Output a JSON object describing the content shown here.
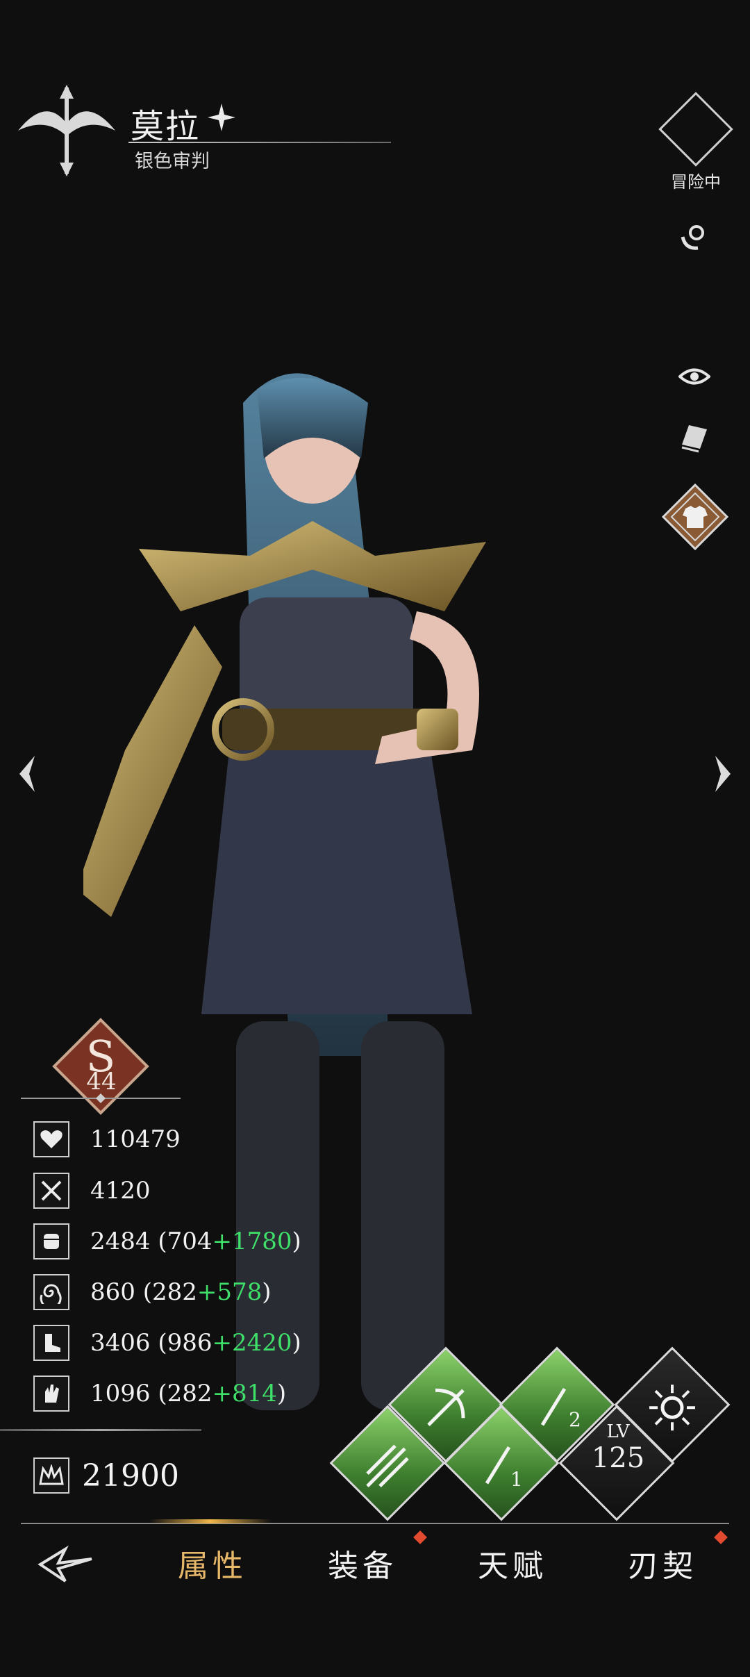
{
  "character": {
    "name": "莫拉",
    "title": "银色审判",
    "status": "冒险中",
    "rank": "44"
  },
  "stats": [
    {
      "icon": "heart-icon",
      "base": "110479",
      "extra_open": "",
      "extra_plus": "",
      "extra_close": ""
    },
    {
      "icon": "crossed-swords-icon",
      "base": "4120",
      "extra_open": "",
      "extra_plus": "",
      "extra_close": ""
    },
    {
      "icon": "fist-icon",
      "base": "2484",
      "extra_open": " (704",
      "extra_plus": "+1780",
      "extra_close": ")"
    },
    {
      "icon": "swirl-icon",
      "base": "860",
      "extra_open": " (282",
      "extra_plus": "+578",
      "extra_close": ")"
    },
    {
      "icon": "boot-icon",
      "base": "3406",
      "extra_open": " (986",
      "extra_plus": "+2420",
      "extra_close": ")"
    },
    {
      "icon": "hand-icon",
      "base": "1096",
      "extra_open": " (282",
      "extra_plus": "+814",
      "extra_close": ")"
    }
  ],
  "power": "21900",
  "skills": {
    "lv_label": "LV",
    "lv_value": "125",
    "slot1_num": "1",
    "slot2_num": "2"
  },
  "nav": {
    "items": [
      "属性",
      "装备",
      "天赋",
      "刃契"
    ],
    "active": "属性"
  },
  "colors": {
    "bonus": "#3fe06a",
    "accent_gold": "#e8b86a",
    "skill_green": "#4f8f3a",
    "rank_red": "#7a3322",
    "nav_dot": "#e24a2f"
  }
}
